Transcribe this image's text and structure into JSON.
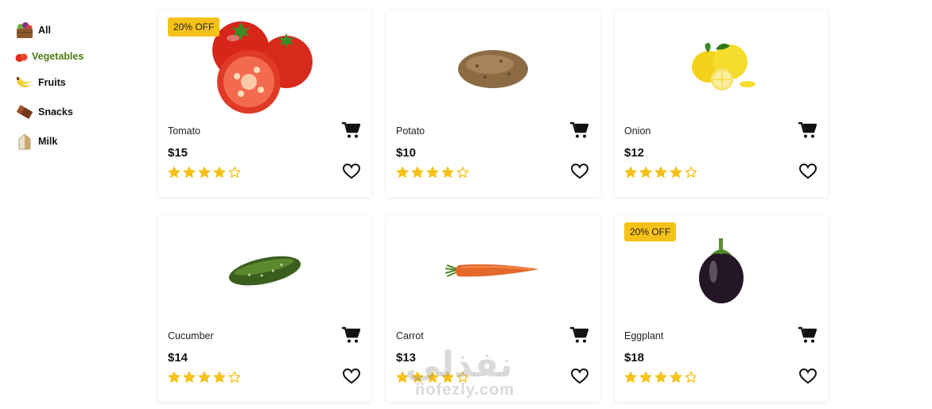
{
  "sidebar": {
    "categories": [
      {
        "label": "All",
        "icon": "fruit-crate-icon",
        "active": false
      },
      {
        "label": "Vegetables",
        "icon": "tomato-icon",
        "active": true
      },
      {
        "label": "Fruits",
        "icon": "banana-icon",
        "active": false
      },
      {
        "label": "Snacks",
        "icon": "chocolate-bar-icon",
        "active": false
      },
      {
        "label": "Milk",
        "icon": "milk-carton-icon",
        "active": false
      }
    ]
  },
  "products": [
    {
      "name": "Tomato",
      "price": "$15",
      "badge": "20% OFF",
      "rating": 4,
      "max_rating": 5,
      "image": "tomato-image"
    },
    {
      "name": "Potato",
      "price": "$10",
      "badge": "",
      "rating": 4,
      "max_rating": 5,
      "image": "potato-image"
    },
    {
      "name": "Onion",
      "price": "$12",
      "badge": "",
      "rating": 4,
      "max_rating": 5,
      "image": "lemon-image"
    },
    {
      "name": "Cucumber",
      "price": "$14",
      "badge": "",
      "rating": 4,
      "max_rating": 5,
      "image": "cucumber-image"
    },
    {
      "name": "Carrot",
      "price": "$13",
      "badge": "",
      "rating": 4,
      "max_rating": 5,
      "image": "carrot-image"
    },
    {
      "name": "Eggplant",
      "price": "$18",
      "badge": "20% OFF",
      "rating": 4,
      "max_rating": 5,
      "image": "eggplant-image"
    }
  ],
  "colors": {
    "star": "#f6c21a",
    "badge": "#f6c21a",
    "active_category": "#4f7a14"
  },
  "watermark": {
    "arabic": "نفذلي",
    "latin": "nofezly.com"
  }
}
